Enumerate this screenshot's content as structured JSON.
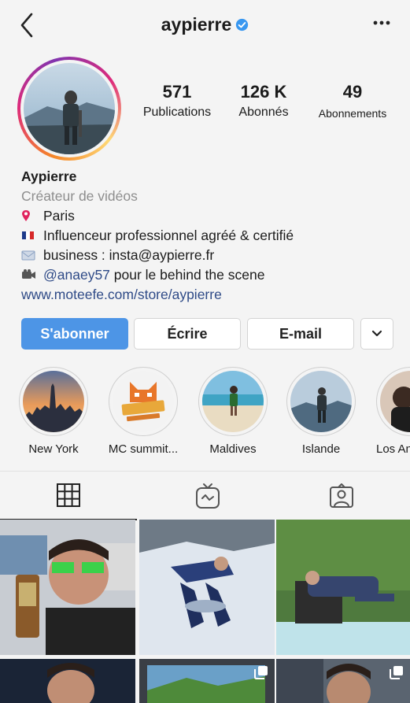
{
  "header": {
    "username": "aypierre"
  },
  "stats": [
    {
      "value": "571",
      "label": "Publications"
    },
    {
      "value": "126 K",
      "label": "Abonnés"
    },
    {
      "value": "49",
      "label": "Abonnements"
    }
  ],
  "bio": {
    "name": "Aypierre",
    "category": "Créateur de vidéos",
    "location": "Paris",
    "line_flag": "Influenceur professionnel agréé & certifié",
    "line_business": "business : insta@aypierre.fr",
    "mention": "@anaey57",
    "mention_suffix": " pour le behind the scene",
    "website": "www.moteefe.com/store/aypierre"
  },
  "actions": {
    "follow": "S'abonner",
    "message": "Écrire",
    "email": "E-mail"
  },
  "highlights": [
    {
      "label": "New York"
    },
    {
      "label": "MC summit..."
    },
    {
      "label": "Maldives"
    },
    {
      "label": "Islande"
    },
    {
      "label": "Los An"
    }
  ],
  "tabs": [
    {
      "icon": "grid-icon"
    },
    {
      "icon": "igtv-icon"
    },
    {
      "icon": "tagged-icon"
    }
  ],
  "colors": {
    "accent": "#4d95e6",
    "link": "#2e4a87",
    "verified": "#3897f0"
  }
}
